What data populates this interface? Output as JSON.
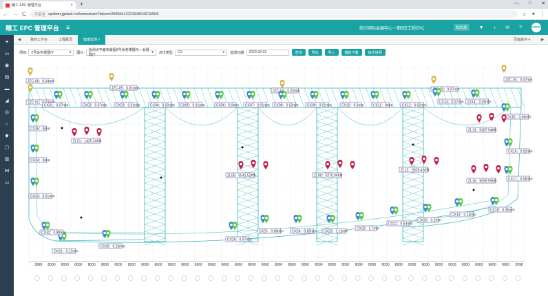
{
  "browser": {
    "tab_title": "精工 EPC 管理平台",
    "close": "×",
    "new_tab": "+",
    "minimize": "—",
    "maximize": "□",
    "win_close": "✕",
    "security": "不安全",
    "url": "epcbim.jgsteel.cn/home/main?token=20090413223938ODFDAD8",
    "back": "←",
    "forward": "→",
    "reload": "C",
    "star": "☆",
    "account": "●",
    "menu_dots": "⋮"
  },
  "header": {
    "app_title": "精工 EPC 管理平台",
    "menu_icon": "≡",
    "project": "绍兴国际会展中心一期B区工程EPC",
    "kb_label": "知识库",
    "username": "admin"
  },
  "sidebar": {
    "icons": [
      "pin-icon",
      "monitor-icon",
      "database-icon",
      "doc-icon",
      "tray-icon",
      "chart-icon",
      "db2-icon",
      "home-icon",
      "bell-icon",
      "desktop-icon",
      "bar-icon",
      "share-icon",
      "screen-icon"
    ]
  },
  "tabs": {
    "prev": "◀",
    "next": "▶",
    "items": [
      {
        "label": "我的工作台",
        "active": false
      },
      {
        "label": "工程概况",
        "active": false
      },
      {
        "label": "健康监测 ×",
        "active": true
      }
    ],
    "page_ops": "页面操作 ▾"
  },
  "filters": {
    "label_1": "项目:",
    "value_1": "2号会务楼展厅",
    "label_2": "图片:",
    "value_2": "监测点平面布置图2号会务楼展厅、会展展厅",
    "label_3": "点位类型:",
    "value_3": "CX",
    "label_4": "监测日期:",
    "value_4": "2020-09-02",
    "caret": "▾",
    "buttons": [
      "查询",
      "导出",
      "导入",
      "模板下载",
      "操作说明"
    ]
  },
  "colors": {
    "teal": "#1aa3a3",
    "sidebar": "#2c3e50",
    "pin_yellow": "#d4b84a",
    "pin_blue": "#3a86d8",
    "pin_green": "#5ac84a",
    "pin_red": "#c0204a",
    "truss": "#35b8b8"
  },
  "sensors": [
    {
      "text": "JZC-06：0.04mm",
      "type": "yellow"
    },
    {
      "text": "JZC-05：0.01mm",
      "type": "yellow"
    },
    {
      "text": "JZC-04：0.02mm",
      "type": "yellow"
    },
    {
      "text": "JZC-03：0.07mm",
      "type": "yellow"
    },
    {
      "text": "JZC-02：0.07mm",
      "type": "yellow"
    },
    {
      "text": "JZC-01：0.02mm",
      "type": "yellow"
    },
    {
      "text": "CX01：0.07mm",
      "type": "blue"
    },
    {
      "text": "CX02：0.07mm",
      "type": "blue"
    },
    {
      "text": "CX03：0.01mm",
      "type": "blue"
    },
    {
      "text": "CX04：0.02mm",
      "type": "blue"
    },
    {
      "text": "CX05：0.01mm",
      "type": "blue"
    },
    {
      "text": "CX06：0.0mm",
      "type": "blue"
    },
    {
      "text": "CX07：0.01mm",
      "type": "blue"
    },
    {
      "text": "CX08：0.02mm",
      "type": "blue"
    },
    {
      "text": "CX09：0.01mm",
      "type": "blue"
    },
    {
      "text": "CX10：0.0mm",
      "type": "blue"
    },
    {
      "text": "CX11：0mm",
      "type": "blue"
    },
    {
      "text": "CX12：0.02mm",
      "type": "blue"
    },
    {
      "text": "CX13：0.07mm",
      "type": "blue"
    },
    {
      "text": "CX14：0.05mm",
      "type": "blue"
    },
    {
      "text": "CX15：0.06mm",
      "type": "blue"
    },
    {
      "text": "CX16：0.02mm",
      "type": "blue"
    },
    {
      "text": "CX17：0.06mm",
      "type": "blue"
    },
    {
      "text": "CX18：0.35mm",
      "type": "blue"
    },
    {
      "text": "CX19：0.14mm",
      "type": "blue"
    },
    {
      "text": "CX20：0.2mm",
      "type": "blue"
    },
    {
      "text": "CX21：0.53mm",
      "type": "blue"
    },
    {
      "text": "CX22：1.7mm",
      "type": "blue"
    },
    {
      "text": "CX23：1.12mm",
      "type": "blue"
    },
    {
      "text": "CX24：0.85mm",
      "type": "blue"
    },
    {
      "text": "CX25：0.88mm",
      "type": "blue"
    },
    {
      "text": "CX26：0.07mm",
      "type": "blue"
    },
    {
      "text": "CX30：0.19mm",
      "type": "blue"
    },
    {
      "text": "CX31：0.12mm",
      "type": "blue"
    },
    {
      "text": "CX32：0.88mm",
      "type": "blue"
    },
    {
      "text": "CX33：0.01mm",
      "type": "blue"
    },
    {
      "text": "CX34：0mm",
      "type": "blue"
    },
    {
      "text": "CX35：0mm",
      "type": "blue"
    },
    {
      "text": "ZL01：1425.24KN",
      "type": "red"
    },
    {
      "text": "ZL05：5541.52KN",
      "type": "red"
    },
    {
      "text": "ZL09：5370.04KN",
      "type": "red"
    },
    {
      "text": "ZL12：5526.43KN",
      "type": "red"
    },
    {
      "text": "ZL13：5387.94KN",
      "type": "red"
    },
    {
      "text": "ZL16：5059.59KN",
      "type": "red"
    }
  ],
  "axis_labels": [
    "3998",
    "8000",
    "8000",
    "8000",
    "8000",
    "8000",
    "8000",
    "8000",
    "8000",
    "8000",
    "8000",
    "8000",
    "8000",
    "8000",
    "8000",
    "8000",
    "8000",
    "8000",
    "8000",
    "8000",
    "8000",
    "8000",
    "8000",
    "8000",
    "8000",
    "8000",
    "8000",
    "8000",
    "8000",
    "8000",
    "8000",
    "8000",
    "8000",
    "8000",
    "8000",
    "8000",
    "3998"
  ]
}
